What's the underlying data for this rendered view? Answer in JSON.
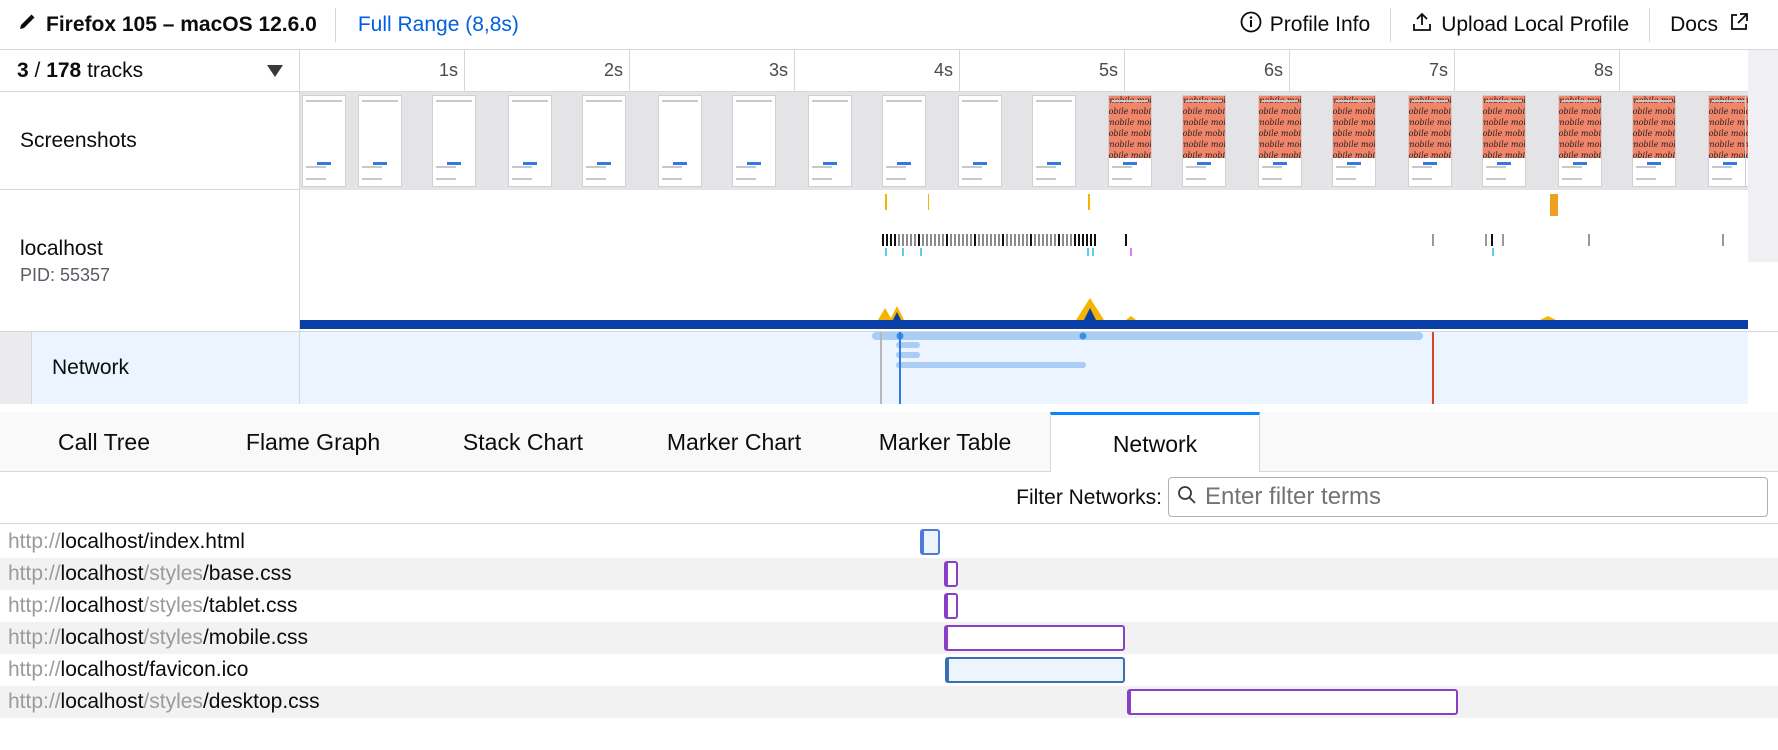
{
  "topbar": {
    "title": "Firefox 105 – macOS 12.6.0",
    "range": "Full Range (8,8s)",
    "profile_info": "Profile Info",
    "upload": "Upload Local Profile",
    "docs": "Docs"
  },
  "timeline": {
    "track_count_visible": "3",
    "track_count_sep": " / ",
    "track_count_total": "178",
    "track_count_word": " tracks",
    "ticks": [
      "1s",
      "2s",
      "3s",
      "4s",
      "5s",
      "6s",
      "7s",
      "8s"
    ],
    "screenshots_label": "Screenshots",
    "screenshot_text": "mobile",
    "process_name": "localhost",
    "process_pid": "PID: 55357",
    "network_label": "Network"
  },
  "tabs": [
    "Call Tree",
    "Flame Graph",
    "Stack Chart",
    "Marker Chart",
    "Marker Table",
    "Network"
  ],
  "active_tab": "Network",
  "filter": {
    "label": "Filter Networks:",
    "placeholder": "Enter filter terms",
    "value": ""
  },
  "requests": [
    {
      "scheme": "http://",
      "host": "localhost",
      "dir": "",
      "file": "/index.html",
      "start_s": 3.76,
      "end_s": 3.88,
      "kind": "document",
      "color": "#4f7bd6"
    },
    {
      "scheme": "http://",
      "host": "localhost",
      "dir": "/styles",
      "file": "/base.css",
      "start_s": 3.9,
      "end_s": 3.99,
      "kind": "stylesheet",
      "color": "#8a3fc7"
    },
    {
      "scheme": "http://",
      "host": "localhost",
      "dir": "/styles",
      "file": "/tablet.css",
      "start_s": 3.9,
      "end_s": 3.99,
      "kind": "stylesheet",
      "color": "#8a3fc7"
    },
    {
      "scheme": "http://",
      "host": "localhost",
      "dir": "/styles",
      "file": "/mobile.css",
      "start_s": 3.9,
      "end_s": 5.0,
      "kind": "stylesheet",
      "color": "#8a3fc7"
    },
    {
      "scheme": "http://",
      "host": "localhost",
      "dir": "",
      "file": "/favicon.ico",
      "start_s": 3.91,
      "end_s": 5.0,
      "kind": "image",
      "color": "#3a6fb3"
    },
    {
      "scheme": "http://",
      "host": "localhost",
      "dir": "/styles",
      "file": "/desktop.css",
      "start_s": 5.01,
      "end_s": 7.02,
      "kind": "stylesheet",
      "color": "#8a3fc7"
    }
  ],
  "colors": {
    "accent": "#0a84ff",
    "link": "#0060df",
    "cpu_band": "#0a3fa8",
    "network_row_bg": "#ebf4ff",
    "screenshot_orange": "#f1856a",
    "load_marker": "#d7432f"
  },
  "icons": [
    "pencil-icon",
    "info-icon",
    "upload-icon",
    "external-link-icon",
    "search-icon",
    "dropdown-arrow-icon"
  ]
}
